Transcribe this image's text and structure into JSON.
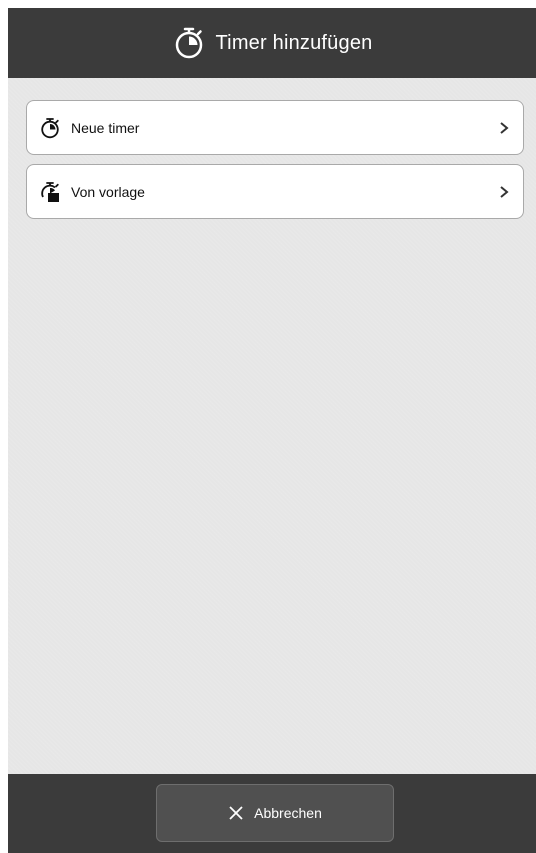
{
  "header": {
    "title": "Timer hinzufügen",
    "icon": "stopwatch-icon"
  },
  "menu": {
    "items": [
      {
        "label": "Neue timer",
        "icon": "stopwatch-icon"
      },
      {
        "label": "Von vorlage",
        "icon": "stopwatch-template-icon"
      }
    ]
  },
  "footer": {
    "cancel_label": "Abbrechen",
    "cancel_icon": "close-icon"
  },
  "colors": {
    "header_bg": "#3b3b3b",
    "content_bg": "#e6e6e6",
    "item_bg": "#ffffff",
    "button_bg": "#505050"
  }
}
